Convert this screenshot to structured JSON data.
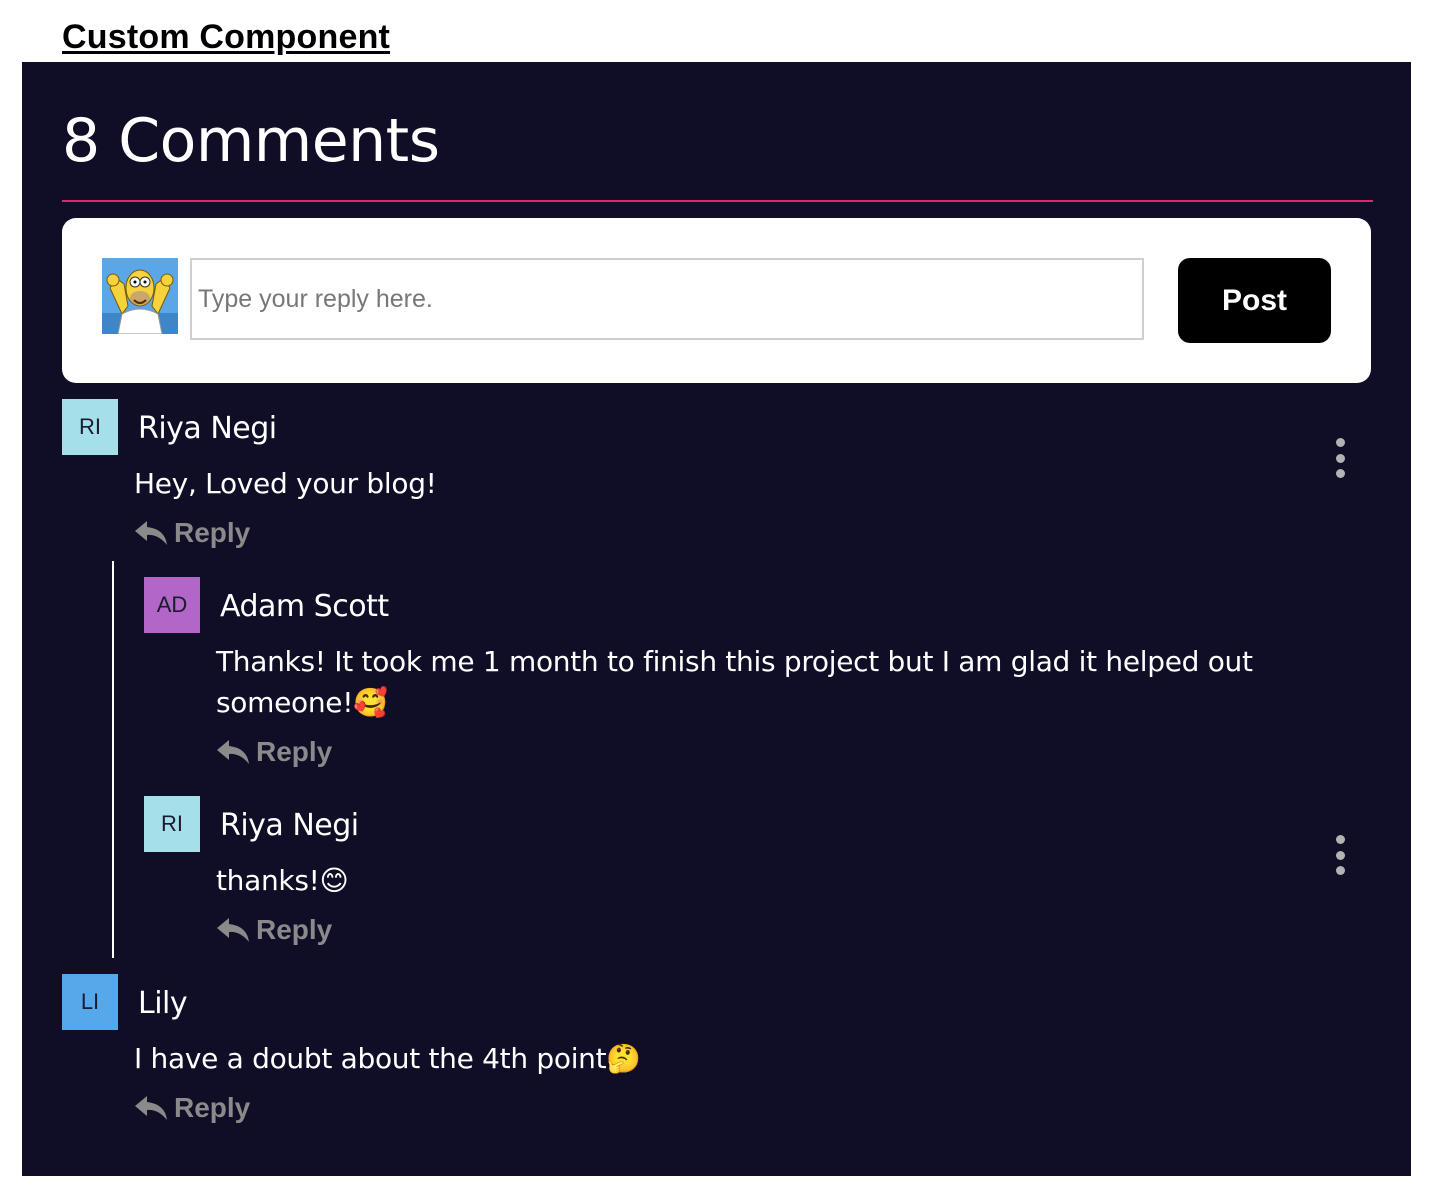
{
  "page_heading": "Custom Component",
  "comments_title": "8 Comments",
  "composer": {
    "placeholder": "Type your reply here.",
    "post_label": "Post"
  },
  "colors": {
    "panel_bg": "#100e27",
    "accent_rule": "#e2256f",
    "avatar_ri": "#a5e0ea",
    "avatar_ad": "#b266c7",
    "avatar_li": "#56a8ea"
  },
  "comments": [
    {
      "initials": "RI",
      "author": "Riya Negi",
      "text": "Hey, Loved your blog!",
      "reply_label": "Reply",
      "replies": [
        {
          "initials": "AD",
          "author": "Adam Scott",
          "text": "Thanks! It took me 1 month to finish this project but I am glad it helped out someone!🥰",
          "reply_label": "Reply"
        },
        {
          "initials": "RI",
          "author": "Riya Negi",
          "text": "thanks!😊",
          "reply_label": "Reply"
        }
      ]
    },
    {
      "initials": "LI",
      "author": "Lily",
      "text": "I have a doubt about the 4th point🤔",
      "reply_label": "Reply"
    }
  ]
}
